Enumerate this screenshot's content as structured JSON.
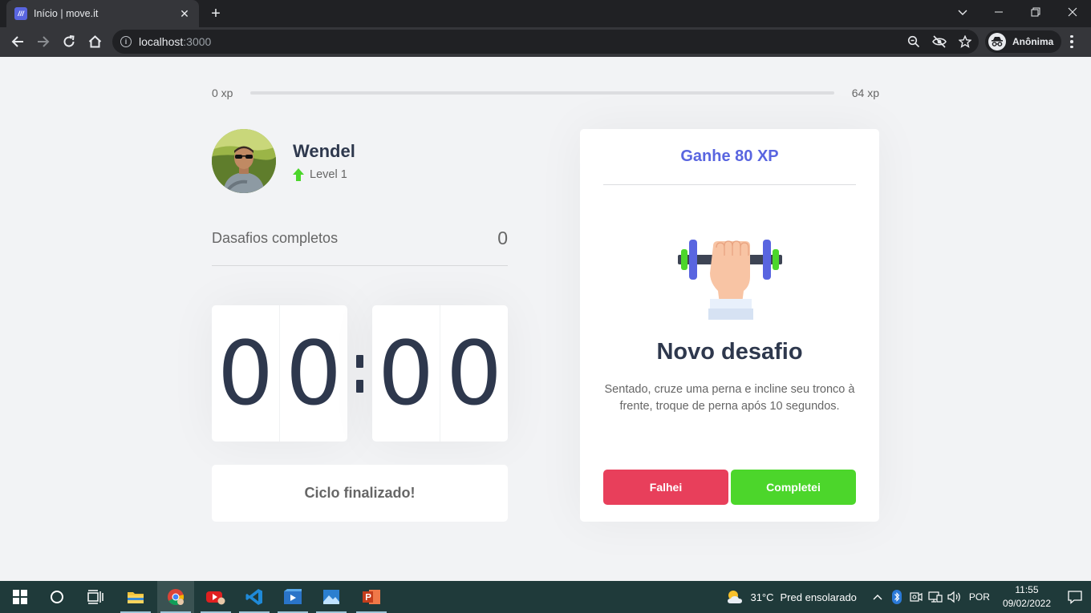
{
  "browser": {
    "tab_title": "Início | move.it",
    "favicon_text": "///",
    "url_host": "localhost",
    "url_port": ":3000",
    "profile_label": "Anônima"
  },
  "xp": {
    "current_label": "0 xp",
    "max_label": "64 xp",
    "progress_fraction": 0
  },
  "user": {
    "name": "Wendel",
    "level_label": "Level 1"
  },
  "completed_challenges": {
    "label": "Dasafios completos",
    "value": "0"
  },
  "countdown": {
    "minute_left": "0",
    "minute_right": "0",
    "second_left": "0",
    "second_right": "0"
  },
  "cycle_button_label": "Ciclo finalizado!",
  "challenge": {
    "header": "Ganhe 80 XP",
    "title": "Novo desafio",
    "description": "Sentado, cruze uma perna e incline seu tronco à frente, troque de perna após 10 segundos.",
    "failed_label": "Falhei",
    "completed_label": "Completei"
  },
  "taskbar": {
    "weather_temp": "31°C",
    "weather_desc": "Pred ensolarado",
    "language": "POR",
    "time": "11:55",
    "date": "09/02/2022"
  },
  "colors": {
    "accent": "#5965e0",
    "success": "#4cd62b",
    "danger": "#e83f5b",
    "title_text": "#2e384d",
    "body_text": "#666666",
    "page_bg": "#f2f3f5"
  }
}
